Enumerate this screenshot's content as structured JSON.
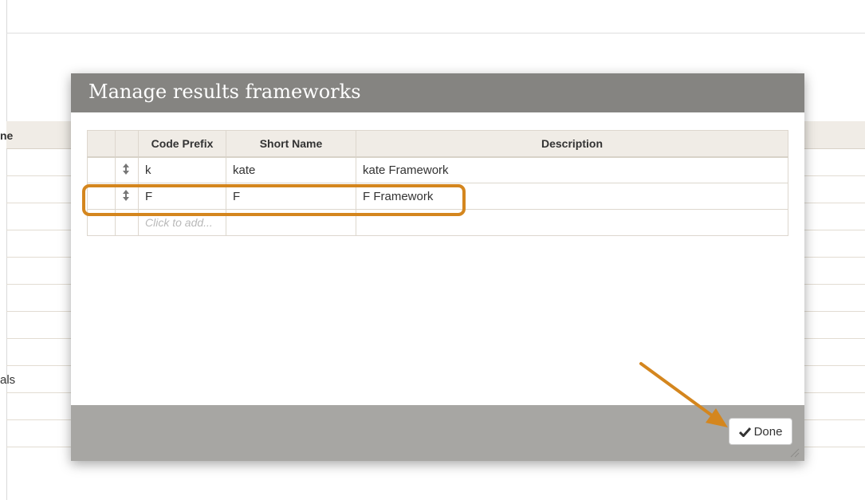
{
  "background": {
    "header_partial": "ne",
    "row_partial": "als"
  },
  "modal": {
    "title": "Manage results frameworks",
    "table": {
      "columns": [
        "",
        "",
        "Code Prefix",
        "Short Name",
        "Description"
      ],
      "rows": [
        {
          "code_prefix": "k",
          "short_name": "kate",
          "description": "kate Framework"
        },
        {
          "code_prefix": "F",
          "short_name": "F",
          "description": "F Framework"
        }
      ],
      "add_placeholder": "Click to add..."
    },
    "footer": {
      "done_label": "Done"
    }
  },
  "annotation": {
    "highlight_color": "#d4861e",
    "highlighted_row": "F"
  },
  "colors": {
    "title_bar": "#858481",
    "footer_bar": "#a7a6a3",
    "table_header": "#f0ece6"
  },
  "icons": {
    "drag": "drag-handle-icon",
    "done": "check-icon",
    "resize": "resize-grip-icon"
  }
}
